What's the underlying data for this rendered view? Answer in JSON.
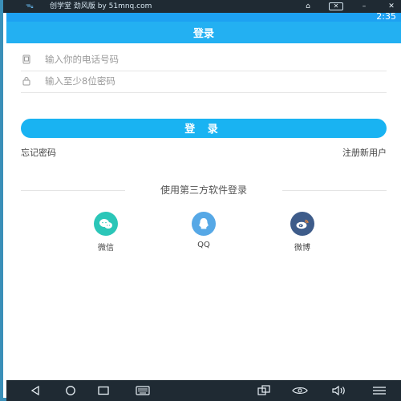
{
  "emulator": {
    "title": "创学堂  劲风版 by 51mnq.com",
    "logo": "ᯓ",
    "buttons": {
      "home": "⌂",
      "close": "✕",
      "minimize": "–",
      "exit": "✕"
    }
  },
  "status_bar": {
    "time": "2:35"
  },
  "header": {
    "title": "登录"
  },
  "form": {
    "phone_placeholder": "输入你的电话号码",
    "password_placeholder": "输入至少8位密码",
    "login_button": "登 录",
    "forgot_password": "忘记密码",
    "register": "注册新用户"
  },
  "social": {
    "heading": "使用第三方软件登录",
    "items": [
      {
        "label": "微信",
        "icon": "wechat-icon",
        "color": "#2bc6b8"
      },
      {
        "label": "QQ",
        "icon": "qq-icon",
        "color": "#56a8e6"
      },
      {
        "label": "微博",
        "icon": "weibo-icon",
        "color": "#3e5c8a"
      }
    ]
  },
  "colors": {
    "accent": "#23b0f2"
  },
  "nav_bar": {
    "icons": [
      "back-icon",
      "home-icon",
      "recents-icon",
      "keyboard-icon",
      "rotate-icon",
      "eye-icon",
      "volume-icon",
      "menu-icon"
    ]
  }
}
